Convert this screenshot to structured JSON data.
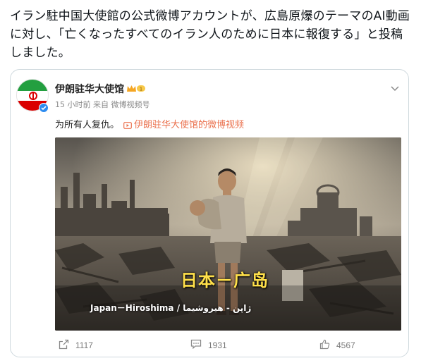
{
  "headline": {
    "text": "イラン駐中国大使館の公式微博アカウントが、広島原爆のテーマのAI動画に対し、「亡くなったすべてのイラン人のために日本に報復する」と投稿しました。"
  },
  "post": {
    "account_name": "伊朗驻华大使馆",
    "meta": "15 小时前  来自 微博视频号",
    "body_text": "为所有人复仇。",
    "video_link": "伊朗驻华大使馆的微博视频",
    "video": {
      "caption_jp": "日本－广岛",
      "caption_en": "Japan－Hiroshima / ژاپن - هیروشیما"
    },
    "actions": {
      "share_count": "1117",
      "comment_count": "1931",
      "like_count": "4567"
    }
  },
  "colors": {
    "link": "#eb7350",
    "caption": "#ffe04a",
    "verified": "#2d8cf0",
    "flag_green": "#239f40",
    "flag_red": "#da0000"
  },
  "icons": [
    "crown-icon",
    "chevron-down-icon",
    "video-icon",
    "share-icon",
    "comment-icon",
    "like-icon",
    "verified-icon"
  ]
}
